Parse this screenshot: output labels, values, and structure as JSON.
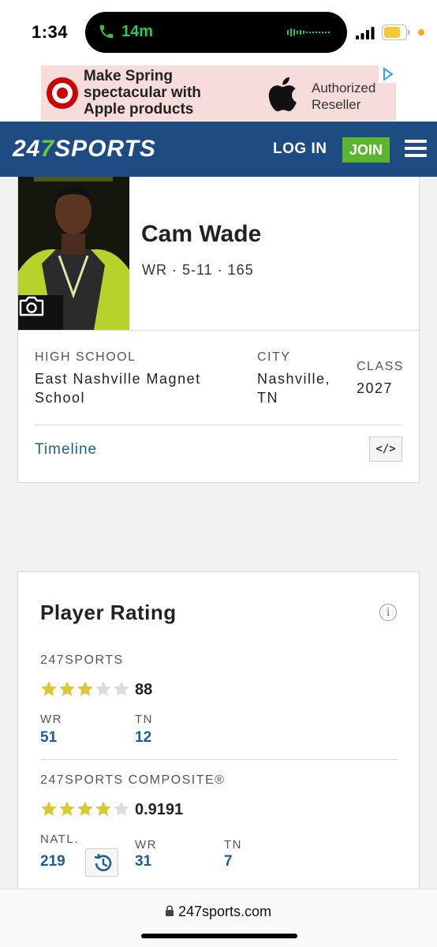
{
  "status_bar": {
    "time": "1:34",
    "call_timer": "14m"
  },
  "ad": {
    "headline": "Make Spring spectacular with Apple products",
    "badge": "Authorized Reseller"
  },
  "nav": {
    "logo_prefix": "24",
    "logo_seven": "7",
    "logo_suffix": "SPORTS",
    "login_label": "LOG IN",
    "join_label": "JOIN"
  },
  "player": {
    "name": "Cam Wade",
    "meta": "WR · 5-11 · 165",
    "high_school_label": "HIGH SCHOOL",
    "high_school": "East Nashville Magnet School",
    "city_label": "CITY",
    "city": "Nashville, TN",
    "class_label": "CLASS",
    "class_year": "2027",
    "timeline_label": "Timeline",
    "embed_label": "</>"
  },
  "rating": {
    "title": "Player Rating",
    "info_label": "i",
    "sports247": {
      "label": "247SPORTS",
      "stars": 3,
      "max_stars": 5,
      "score": "88",
      "ranks": [
        {
          "label": "WR",
          "value": "51"
        },
        {
          "label": "TN",
          "value": "12"
        }
      ]
    },
    "composite": {
      "label": "247SPORTS COMPOSITE®",
      "stars": 4,
      "max_stars": 5,
      "score": "0.9191",
      "ranks": [
        {
          "label": "NATL.",
          "value": "219"
        },
        {
          "label": "WR",
          "value": "31"
        },
        {
          "label": "TN",
          "value": "7"
        }
      ]
    }
  },
  "browser": {
    "url": "247sports.com"
  },
  "colors": {
    "nav_bg": "#1d4b82",
    "join_bg": "#5cb531",
    "link_blue": "#1e5f92",
    "star_filled": "#d9c832",
    "star_empty": "#dcdcdc"
  }
}
